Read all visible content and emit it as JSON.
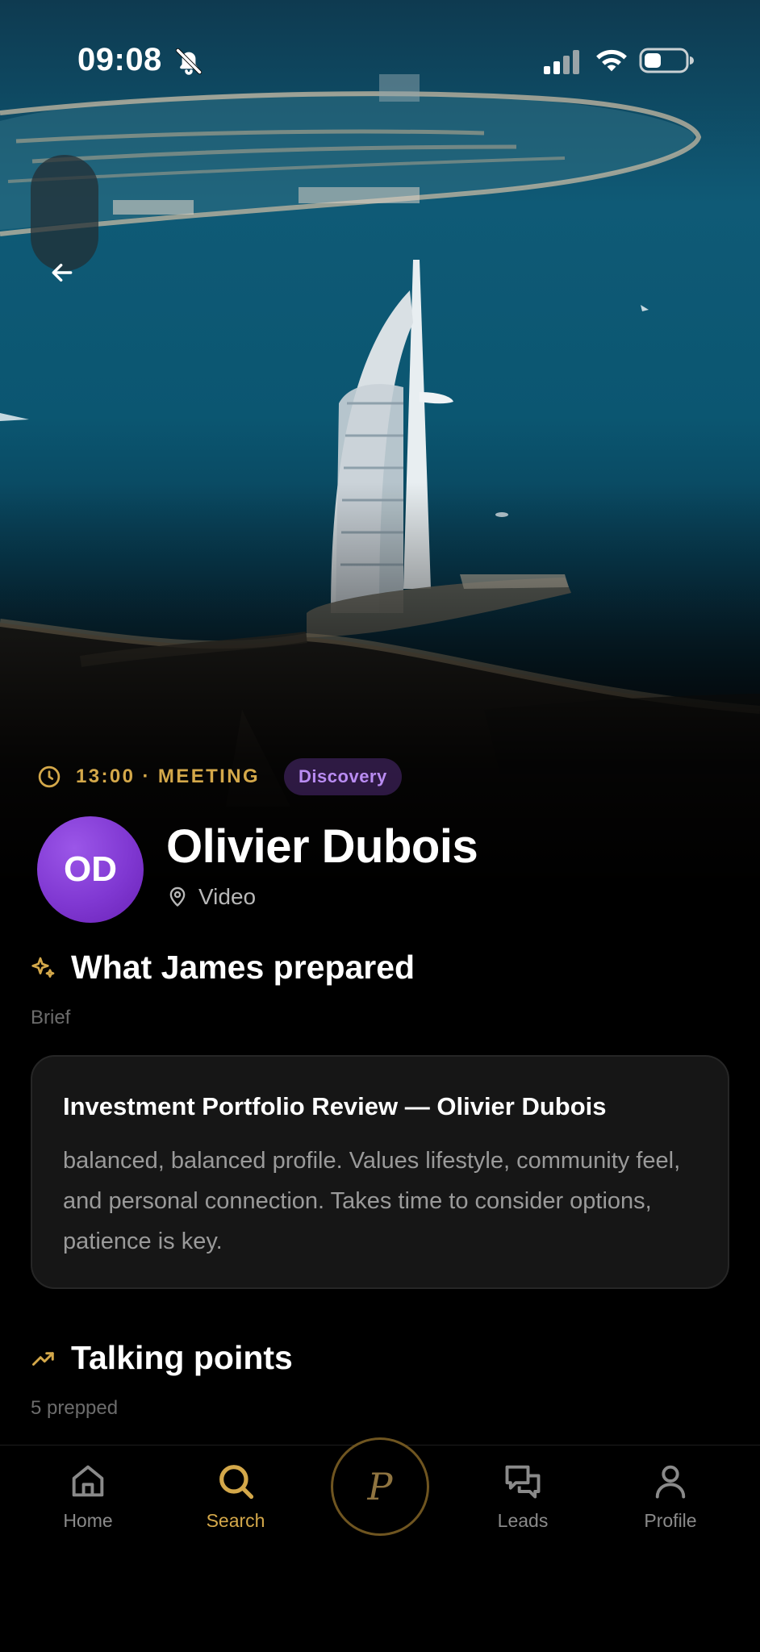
{
  "status_bar": {
    "time": "09:08",
    "icons": [
      "bell-slash-icon",
      "cellular-signal-icon",
      "wifi-icon",
      "battery-icon"
    ]
  },
  "hero": {
    "image": "aerial-photo-burj-al-arab-palm-jumeirah",
    "back_icon": "arrow-left-icon"
  },
  "meeting": {
    "time_type": "13:00 · MEETING",
    "tag": "Discovery",
    "clock_icon": "clock-icon"
  },
  "contact": {
    "initials": "OD",
    "name": "Olivier Dubois",
    "location": "Video",
    "location_icon": "map-pin-icon"
  },
  "prepared": {
    "title": "What James prepared",
    "subtitle": "Brief",
    "icon": "sparkles-icon"
  },
  "brief": {
    "title": "Investment Portfolio Review — Olivier Dubois",
    "body": "balanced, balanced profile. Values lifestyle, community feel, and personal connection. Takes time to consider options, patience is key."
  },
  "talking_points": {
    "title": "Talking points",
    "subtitle": "5 prepped",
    "icon": "trending-up-icon"
  },
  "tab_bar": {
    "items": [
      {
        "label": "Home",
        "icon": "home-icon"
      },
      {
        "label": "Search",
        "icon": "search-icon",
        "active": true
      },
      {
        "label": "P",
        "icon": "center-logo"
      },
      {
        "label": "Leads",
        "icon": "chat-bubbles-icon"
      },
      {
        "label": "Profile",
        "icon": "person-icon"
      }
    ]
  },
  "colors": {
    "accent_gold": "#d4a84a",
    "tag_purple": "#b98cf2",
    "avatar_purple": "#8038d2",
    "background": "#000000",
    "card": "#161616"
  }
}
